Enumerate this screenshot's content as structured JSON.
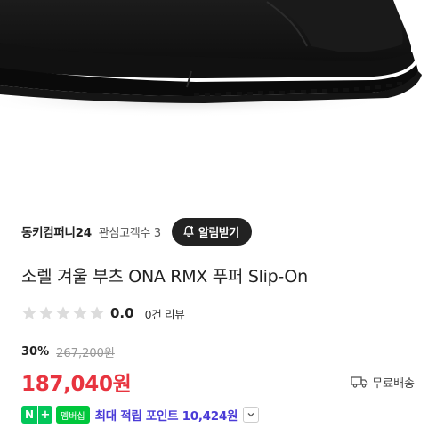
{
  "product_image": {
    "alt_icon": "black-winter-boot-image"
  },
  "store": {
    "name": "동키컴퍼니24",
    "follow_label": "관심고객수 3",
    "alarm_button_label": "알림받기"
  },
  "product": {
    "title": "소렐 겨울 부츠 ONA RMX 푸퍼 Slip-On"
  },
  "rating": {
    "value": "0.0",
    "stars_filled": 0,
    "stars_total": 5,
    "review_count_label": "0건 리뷰"
  },
  "pricing": {
    "discount": "30%",
    "original_price": "267,200원",
    "sale_price": "187,040원",
    "shipping_label": "무료배송"
  },
  "points": {
    "badge_n": "N",
    "badge_plus": "+",
    "badge_member": "멤버십",
    "text": "최대 적립 포인트 10,424원"
  },
  "colors": {
    "price": "#e8343f",
    "points": "#4a3bd7",
    "naver_green": "#03c75a",
    "button_bg": "#222222"
  }
}
